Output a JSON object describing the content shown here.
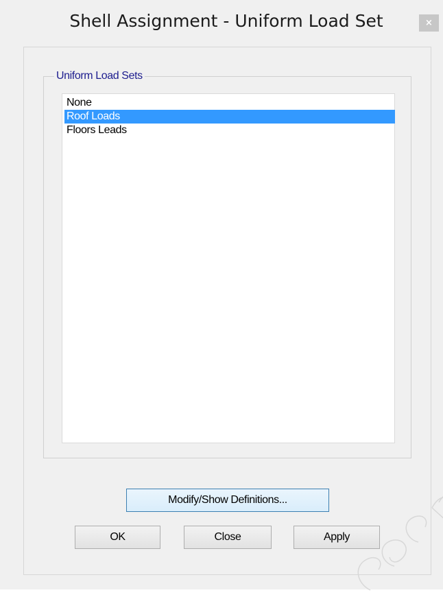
{
  "window": {
    "title": "Shell Assignment - Uniform Load Set",
    "close_label": "×"
  },
  "group": {
    "label": "Uniform Load Sets",
    "items": [
      {
        "label": "None",
        "selected": false
      },
      {
        "label": "Roof Loads",
        "selected": true
      },
      {
        "label": "Floors Leads",
        "selected": false
      }
    ]
  },
  "buttons": {
    "modify_label": "Modify/Show Definitions...",
    "ok_label": "OK",
    "close_label": "Close",
    "apply_label": "Apply"
  },
  "watermark": {
    "text": "cocm"
  },
  "colors": {
    "selection": "#3399ff",
    "group_label": "#1c1c8e",
    "dialog_bg": "#f0f0f0"
  }
}
